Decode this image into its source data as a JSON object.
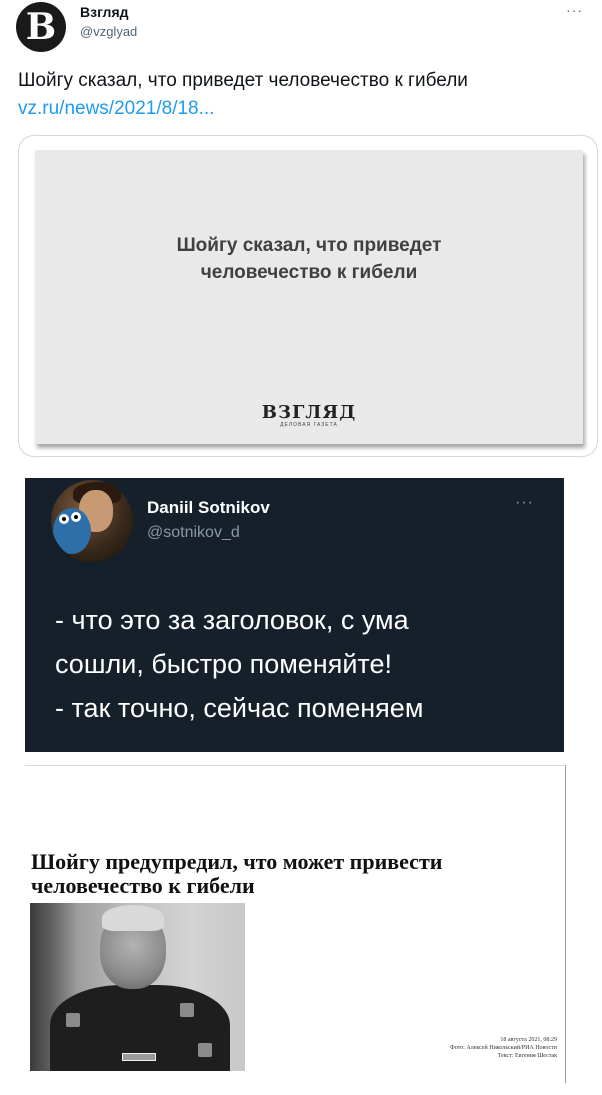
{
  "tweet1": {
    "avatar_letter": "B",
    "author_name": "Взгляд",
    "author_handle": "@vzglyad",
    "more": "···",
    "text": "Шойгу сказал, что приведет человечество к гибели",
    "link": "vz.ru/news/2021/8/18...",
    "card": {
      "headline": "Шойгу сказал, что приведет человечество к гибели",
      "logo": "ВЗГЛЯД",
      "logo_sub": "ДЕЛОВАЯ ГАЗЕТА"
    },
    "colors": {
      "link": "#1d9bf0",
      "text": "#0f1419"
    }
  },
  "tweet2": {
    "author_name": "Daniil Sotnikov",
    "author_handle": "@sotnikov_d",
    "more": "···",
    "lines": [
      "- что это за заголовок, с ума",
      "сошли, быстро поменяйте!",
      "- так точно, сейчас поменяем"
    ],
    "colors": {
      "background": "#15202b",
      "text": "#ffffff",
      "muted": "#8899a6"
    }
  },
  "article": {
    "headline": "Шойгу предупредил, что может привести человечество к гибели",
    "photo_badge_text": "ШОЙГУ С.К.",
    "meta": {
      "date": "18 августа 2021, 08:29",
      "photo_credit": "Фото: Алексей Никольский/РИА Новости",
      "text_credit": "Текст: Евгения Шестак"
    }
  }
}
